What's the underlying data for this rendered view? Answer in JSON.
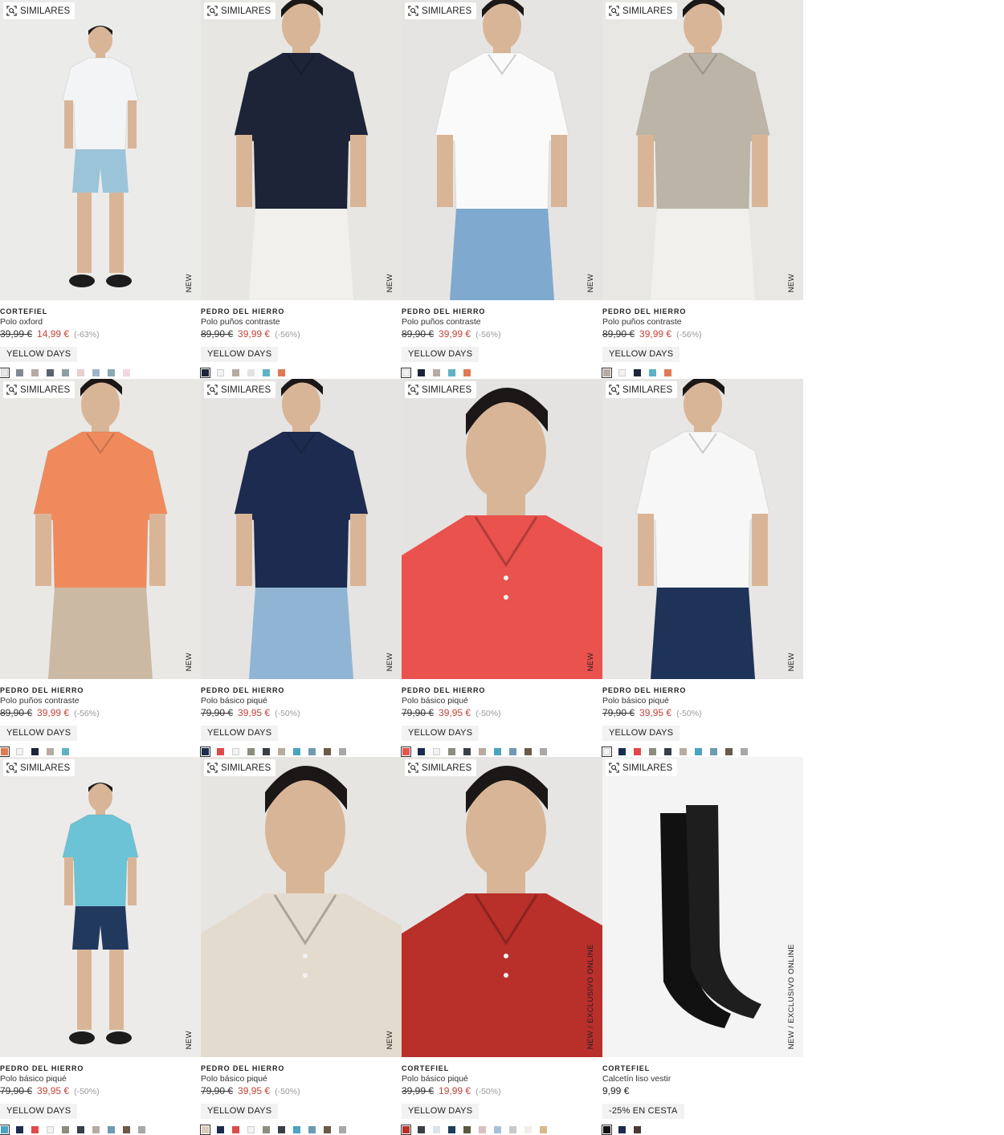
{
  "ui": {
    "similares_label": "SIMILARES"
  },
  "products": [
    {
      "brand": "CORTEFIEL",
      "name": "Polo oxford",
      "original_price": "39,99 €",
      "sale_price": "14,99 €",
      "discount": "(-63%)",
      "badge": "YELLOW DAYS",
      "tag": "NEW",
      "shirt_color": "#f3f4f5",
      "bottom_color": "#9cc4d8",
      "bg_color": "#ebebea",
      "kind": "full",
      "swatches": [
        "#e8e8e8",
        "#7f8a96",
        "#b7a9a4",
        "#5a6470",
        "#8f9ea6",
        "#e7d0cf",
        "#9fb4c9",
        "#8aa9b3",
        "#f3d7e0"
      ]
    },
    {
      "brand": "PEDRO DEL HIERRO",
      "name": "Polo puños contraste",
      "original_price": "89,90 €",
      "sale_price": "39,99 €",
      "discount": "(-56%)",
      "badge": "YELLOW DAYS",
      "tag": "NEW",
      "shirt_color": "#1d2438",
      "bottom_color": "#f1f0ec",
      "bg_color": "#e7e6e3",
      "kind": "half",
      "swatches": [
        "#1d2438",
        "#f2f2f2",
        "#b7aba0",
        "#e2e2e2",
        "#5fb2c3",
        "#e07a55"
      ]
    },
    {
      "brand": "PEDRO DEL HIERRO",
      "name": "Polo puños contraste",
      "original_price": "89,90 €",
      "sale_price": "39,99 €",
      "discount": "(-56%)",
      "badge": "YELLOW DAYS",
      "tag": "NEW",
      "shirt_color": "#fafafa",
      "bottom_color": "#7fa9cf",
      "bg_color": "#e5e4e2",
      "kind": "half",
      "swatches": [
        "#f0f0f0",
        "#1d2438",
        "#b7aba0",
        "#5fb2c3",
        "#e07a55"
      ]
    },
    {
      "brand": "PEDRO DEL HIERRO",
      "name": "Polo puños contraste",
      "original_price": "89,90 €",
      "sale_price": "39,99 €",
      "discount": "(-56%)",
      "badge": "YELLOW DAYS",
      "tag": "NEW",
      "shirt_color": "#bcb4a6",
      "bottom_color": "#f1f0ec",
      "bg_color": "#e8e7e4",
      "kind": "half",
      "swatches": [
        "#b7aba0",
        "#f2f2f2",
        "#1d2438",
        "#5fb2c3",
        "#e07a55"
      ]
    },
    {
      "brand": "PEDRO DEL HIERRO",
      "name": "Polo puños contraste",
      "original_price": "89,90 €",
      "sale_price": "39,99 €",
      "discount": "(-56%)",
      "badge": "YELLOW DAYS",
      "tag": "NEW",
      "shirt_color": "#f08a5d",
      "bottom_color": "#cbb9a3",
      "bg_color": "#e9e8e5",
      "kind": "half",
      "swatches": [
        "#e07a55",
        "#f2f2f2",
        "#1d2438",
        "#b7aba0",
        "#5fb2c3"
      ]
    },
    {
      "brand": "PEDRO DEL HIERRO",
      "name": "Polo básico piqué",
      "original_price": "79,90 €",
      "sale_price": "39,95 €",
      "discount": "(-50%)",
      "badge": "YELLOW DAYS",
      "tag": "NEW",
      "shirt_color": "#1c2b4f",
      "bottom_color": "#90b5d4",
      "bg_color": "#e5e4e2",
      "kind": "half",
      "swatches": [
        "#1c2b4f",
        "#e04a4a",
        "#f2f2f2",
        "#8b8d7e",
        "#3a3f46",
        "#b7aba0",
        "#4aa3c0",
        "#6e9bb3",
        "#6a5a48",
        "#a8a8a8"
      ]
    },
    {
      "brand": "PEDRO DEL HIERRO",
      "name": "Polo básico piqué",
      "original_price": "79,90 €",
      "sale_price": "39,95 €",
      "discount": "(-50%)",
      "badge": "YELLOW DAYS",
      "tag": "NEW",
      "shirt_color": "#e9524d",
      "bottom_color": "#e9524d",
      "bg_color": "#e4e3e1",
      "kind": "closeup",
      "swatches": [
        "#e9524d",
        "#1c2b4f",
        "#f2f2f2",
        "#8b8d7e",
        "#3a3f46",
        "#b7aba0",
        "#4aa3c0",
        "#6e9bb3",
        "#6a5a48",
        "#a8a8a8"
      ]
    },
    {
      "brand": "PEDRO DEL HIERRO",
      "name": "Polo básico piqué",
      "original_price": "79,90 €",
      "sale_price": "39,95 €",
      "discount": "(-50%)",
      "badge": "YELLOW DAYS",
      "tag": "NEW",
      "shirt_color": "#f7f7f7",
      "bottom_color": "#1f3358",
      "bg_color": "#e7e6e4",
      "kind": "half",
      "swatches": [
        "#f2f2f2",
        "#1c2b4f",
        "#e04a4a",
        "#8b8d7e",
        "#3a3f46",
        "#b7aba0",
        "#4aa3c0",
        "#6e9bb3",
        "#6a5a48",
        "#a8a8a8"
      ]
    },
    {
      "brand": "PEDRO DEL HIERRO",
      "name": "Polo básico piqué",
      "original_price": "79,90 €",
      "sale_price": "39,95 €",
      "discount": "(-50%)",
      "badge": "YELLOW DAYS",
      "tag": "NEW",
      "shirt_color": "#6cc3d6",
      "bottom_color": "#22395e",
      "bg_color": "#ecebe9",
      "kind": "full",
      "swatches": [
        "#4aa3c0",
        "#1c2b4f",
        "#e04a4a",
        "#f2f2f2",
        "#8b8d7e",
        "#3a3f46",
        "#b7aba0",
        "#6e9bb3",
        "#6a5a48",
        "#a8a8a8"
      ]
    },
    {
      "brand": "PEDRO DEL HIERRO",
      "name": "Polo básico piqué",
      "original_price": "79,90 €",
      "sale_price": "39,95 €",
      "discount": "(-50%)",
      "badge": "YELLOW DAYS",
      "tag": "NEW",
      "shirt_color": "#e4dbcf",
      "bottom_color": "#e4dbcf",
      "bg_color": "#e7e5e1",
      "kind": "closeup",
      "swatches": [
        "#d8ccbd",
        "#1c2b4f",
        "#e04a4a",
        "#f2f2f2",
        "#8b8d7e",
        "#3a3f46",
        "#4aa3c0",
        "#6e9bb3",
        "#6a5a48",
        "#a8a8a8"
      ]
    },
    {
      "brand": "CORTEFIEL",
      "name": "Polo básico piqué",
      "original_price": "39,99 €",
      "sale_price": "19,99 €",
      "discount": "(-50%)",
      "badge": "YELLOW DAYS",
      "tag": "NEW  /  EXCLUSIVO ONLINE",
      "shirt_color": "#b92f2a",
      "bottom_color": "#b92f2a",
      "bg_color": "#e6e5e3",
      "kind": "closeup",
      "swatches": [
        "#b92f2a",
        "#3a3f46",
        "#dce3ea",
        "#1d3d5c",
        "#5a5a3e",
        "#d9bfc1",
        "#a8c1d8",
        "#c9c9c9",
        "#f2efe6",
        "#d8b98a"
      ]
    },
    {
      "brand": "CORTEFIEL",
      "name": "Calcetín liso vestir",
      "original_price": "",
      "sale_price": "",
      "discount": "",
      "price": "9,99 €",
      "badge": "-25% EN CESTA",
      "tag": "NEW  /  EXCLUSIVO ONLINE",
      "shirt_color": "#111111",
      "bottom_color": "#111111",
      "bg_color": "#f4f4f4",
      "kind": "socks",
      "swatches": [
        "#111111",
        "#1c2b4f",
        "#4a3a33"
      ]
    }
  ]
}
